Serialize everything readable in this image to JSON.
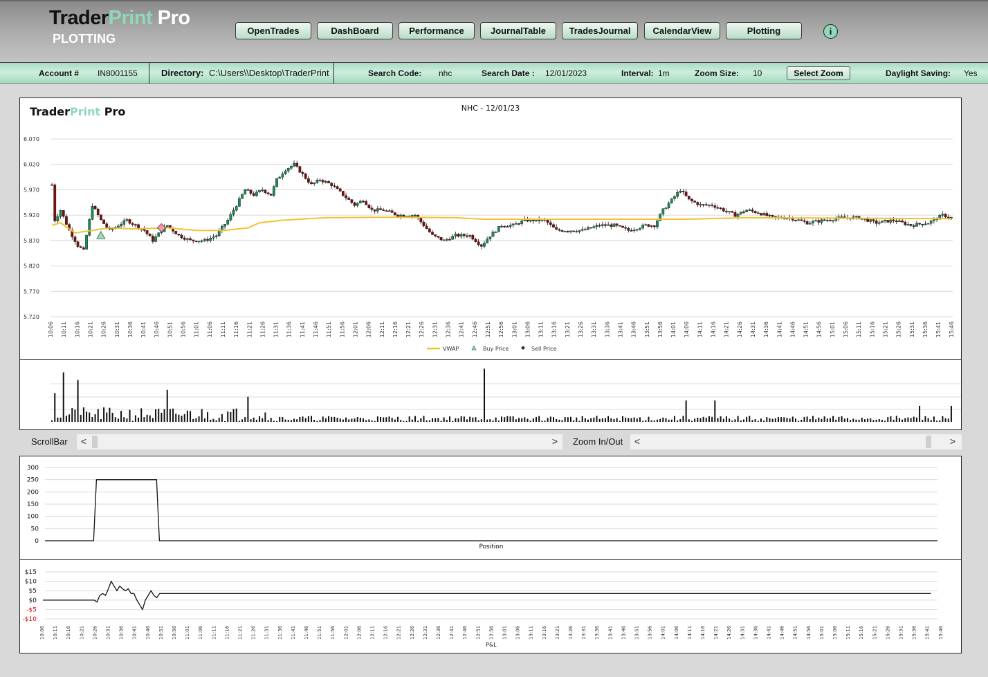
{
  "header": {
    "brand": {
      "part1": "Trader",
      "part2": "Print",
      "part3": " Pro"
    },
    "subtitle": "PLOTTING",
    "nav": [
      "OpenTrades",
      "DashBoard",
      "Performance",
      "JournalTable",
      "TradesJournal",
      "CalendarView",
      "Plotting"
    ],
    "info_icon": "i"
  },
  "toolbar": {
    "account_label": "Account #",
    "account_value": "IN8001155",
    "directory_label": "Directory:",
    "directory_value": "C:\\Users\\\\Desktop\\TraderPrint P",
    "search_code_label": "Search Code:",
    "search_code_value": "nhc",
    "search_date_label": "Search Date :",
    "search_date_value": "12/01/2023",
    "interval_label": "Interval:",
    "interval_value": "1m",
    "zoom_size_label": "Zoom Size:",
    "zoom_size_value": "10",
    "select_zoom_label": "Select Zoom",
    "daylight_label": "Daylight Saving:",
    "daylight_value": "Yes"
  },
  "scroll": {
    "scrollbar_label": "ScrollBar",
    "zoom_label": "Zoom In/Out",
    "left_arrow": "<",
    "right_arrow": ">",
    "scroll_position": 0.0,
    "zoom_position": 1.0
  },
  "colors": {
    "up": "#1e8a5a",
    "down": "#7a1010",
    "vwap": "#f2c12e",
    "buy": "#9fd9b9",
    "sell": "#f19aa8",
    "brand_accent": "#8fd8b8",
    "neg": "#d00000"
  },
  "chart_data": [
    {
      "type": "candlestick",
      "title": "NHC - 12/01/23",
      "watermark": {
        "part1": "Trader",
        "part2": "Print",
        "part3": " Pro"
      },
      "ylim": [
        5.72,
        6.07
      ],
      "yticks": [
        "5.720",
        "5.770",
        "5.820",
        "5.870",
        "5.920",
        "5.970",
        "6.020",
        "6.070"
      ],
      "xticks": [
        "10:06",
        "10:11",
        "10:16",
        "10:21",
        "10:26",
        "10:31",
        "10:36",
        "10:41",
        "10:46",
        "10:51",
        "10:56",
        "11:01",
        "11:06",
        "11:11",
        "11:16",
        "11:21",
        "11:26",
        "11:31",
        "11:36",
        "11:41",
        "11:46",
        "11:51",
        "11:56",
        "12:01",
        "12:06",
        "12:11",
        "12:16",
        "12:21",
        "12:26",
        "12:31",
        "12:36",
        "12:41",
        "12:46",
        "12:51",
        "12:56",
        "13:01",
        "13:06",
        "13:11",
        "13:16",
        "13:21",
        "13:26",
        "13:31",
        "13:36",
        "13:41",
        "13:46",
        "13:51",
        "13:56",
        "14:01",
        "14:06",
        "14:11",
        "14:16",
        "14:21",
        "14:26",
        "14:31",
        "14:36",
        "14:41",
        "14:46",
        "14:51",
        "14:56",
        "15:01",
        "15:06",
        "15:11",
        "15:16",
        "15:21",
        "15:26",
        "15:31",
        "15:36",
        "15:41",
        "15:46"
      ],
      "legend": [
        "VWAP",
        "Buy Price",
        "Sell Price"
      ],
      "legend_position": "bottom",
      "close_path_keypoints": [
        [
          0,
          5.98
        ],
        [
          1,
          5.91
        ],
        [
          3,
          5.93
        ],
        [
          6,
          5.89
        ],
        [
          9,
          5.86
        ],
        [
          11,
          5.85
        ],
        [
          14,
          5.94
        ],
        [
          17,
          5.91
        ],
        [
          20,
          5.89
        ],
        [
          23,
          5.9
        ],
        [
          26,
          5.91
        ],
        [
          29,
          5.9
        ],
        [
          32,
          5.89
        ],
        [
          35,
          5.87
        ],
        [
          38,
          5.89
        ],
        [
          40,
          5.9
        ],
        [
          44,
          5.88
        ],
        [
          48,
          5.87
        ],
        [
          53,
          5.87
        ],
        [
          57,
          5.88
        ],
        [
          61,
          5.91
        ],
        [
          64,
          5.94
        ],
        [
          67,
          5.97
        ],
        [
          70,
          5.96
        ],
        [
          73,
          5.97
        ],
        [
          76,
          5.96
        ],
        [
          78,
          5.99
        ],
        [
          81,
          6.01
        ],
        [
          84,
          6.02
        ],
        [
          87,
          6.0
        ],
        [
          90,
          5.98
        ],
        [
          93,
          5.99
        ],
        [
          97,
          5.98
        ],
        [
          101,
          5.96
        ],
        [
          105,
          5.94
        ],
        [
          108,
          5.95
        ],
        [
          111,
          5.93
        ],
        [
          115,
          5.93
        ],
        [
          120,
          5.92
        ],
        [
          126,
          5.92
        ],
        [
          129,
          5.9
        ],
        [
          132,
          5.88
        ],
        [
          136,
          5.87
        ],
        [
          140,
          5.88
        ],
        [
          145,
          5.88
        ],
        [
          149,
          5.86
        ],
        [
          152,
          5.88
        ],
        [
          156,
          5.9
        ],
        [
          160,
          5.9
        ],
        [
          164,
          5.91
        ],
        [
          168,
          5.91
        ],
        [
          171,
          5.91
        ],
        [
          175,
          5.89
        ],
        [
          180,
          5.89
        ],
        [
          184,
          5.89
        ],
        [
          190,
          5.9
        ],
        [
          195,
          5.9
        ],
        [
          200,
          5.89
        ],
        [
          206,
          5.9
        ],
        [
          209,
          5.9
        ],
        [
          212,
          5.93
        ],
        [
          215,
          5.95
        ],
        [
          218,
          5.97
        ],
        [
          221,
          5.95
        ],
        [
          225,
          5.94
        ],
        [
          229,
          5.94
        ],
        [
          233,
          5.93
        ],
        [
          237,
          5.92
        ],
        [
          241,
          5.93
        ],
        [
          245,
          5.925
        ],
        [
          250,
          5.915
        ],
        [
          256,
          5.915
        ],
        [
          262,
          5.905
        ],
        [
          268,
          5.91
        ],
        [
          274,
          5.915
        ],
        [
          280,
          5.915
        ],
        [
          286,
          5.905
        ],
        [
          292,
          5.91
        ],
        [
          298,
          5.9
        ],
        [
          304,
          5.905
        ],
        [
          309,
          5.92
        ],
        [
          312,
          5.915
        ]
      ],
      "vwap_keypoints": [
        [
          0,
          5.9
        ],
        [
          3,
          5.905
        ],
        [
          8,
          5.885
        ],
        [
          14,
          5.89
        ],
        [
          20,
          5.895
        ],
        [
          28,
          5.893
        ],
        [
          40,
          5.895
        ],
        [
          50,
          5.89
        ],
        [
          60,
          5.89
        ],
        [
          68,
          5.895
        ],
        [
          72,
          5.905
        ],
        [
          80,
          5.91
        ],
        [
          95,
          5.915
        ],
        [
          120,
          5.916
        ],
        [
          140,
          5.915
        ],
        [
          150,
          5.912
        ],
        [
          220,
          5.912
        ],
        [
          240,
          5.915
        ],
        [
          312,
          5.913
        ]
      ],
      "trades": [
        {
          "type": "buy",
          "index": 17,
          "price": 5.88
        },
        {
          "type": "sell",
          "index": 38,
          "price": 5.895
        }
      ]
    },
    {
      "type": "bar",
      "title": "Volume",
      "spikes": [
        [
          1,
          0.38
        ],
        [
          4,
          0.65
        ],
        [
          9,
          0.55
        ],
        [
          40,
          0.42
        ],
        [
          68,
          0.33
        ],
        [
          150,
          0.7
        ],
        [
          220,
          0.28
        ],
        [
          230,
          0.28
        ],
        [
          301,
          0.21
        ],
        [
          312,
          0.21
        ]
      ]
    },
    {
      "type": "line",
      "xlabel": "Position",
      "ylim": [
        0,
        300
      ],
      "yticks": [
        "0",
        "50",
        "100",
        "150",
        "200",
        "250",
        "300"
      ],
      "x_range": [
        0,
        312
      ],
      "points": [
        [
          0,
          0
        ],
        [
          17,
          0
        ],
        [
          18,
          250
        ],
        [
          39,
          250
        ],
        [
          40,
          0
        ],
        [
          312,
          0
        ]
      ]
    },
    {
      "type": "line",
      "xlabel": "P&L",
      "ylim": [
        -10,
        15
      ],
      "yticks": [
        "-$10",
        "-$5",
        "$0",
        "$5",
        "$10",
        "$15"
      ],
      "xticks": [
        "10:06",
        "10:11",
        "10:16",
        "10:21",
        "10:26",
        "10:31",
        "10:36",
        "10:41",
        "10:46",
        "10:51",
        "10:56",
        "11:01",
        "11:06",
        "11:11",
        "11:16",
        "11:21",
        "11:26",
        "11:31",
        "11:36",
        "11:41",
        "11:46",
        "11:51",
        "11:56",
        "12:01",
        "12:06",
        "12:11",
        "12:16",
        "12:21",
        "12:26",
        "12:31",
        "12:36",
        "12:41",
        "12:46",
        "12:51",
        "12:56",
        "13:01",
        "13:06",
        "13:11",
        "13:16",
        "13:21",
        "13:26",
        "13:31",
        "13:36",
        "13:41",
        "13:46",
        "13:51",
        "13:56",
        "14:01",
        "14:06",
        "14:11",
        "14:16",
        "14:21",
        "14:26",
        "14:31",
        "14:36",
        "14:41",
        "14:46",
        "14:51",
        "14:56",
        "15:01",
        "15:06",
        "15:11",
        "15:16",
        "15:21",
        "15:26",
        "15:31",
        "15:36",
        "15:41",
        "15:46"
      ],
      "points": [
        [
          0,
          0
        ],
        [
          18,
          0
        ],
        [
          19,
          -1
        ],
        [
          20,
          2.5
        ],
        [
          21,
          3.5
        ],
        [
          22,
          2.5
        ],
        [
          23,
          6
        ],
        [
          24,
          10
        ],
        [
          25,
          7.5
        ],
        [
          26,
          5
        ],
        [
          27,
          7.5
        ],
        [
          28,
          6
        ],
        [
          29,
          5
        ],
        [
          30,
          6
        ],
        [
          31,
          3.5
        ],
        [
          32,
          3.5
        ],
        [
          33,
          0
        ],
        [
          34,
          -2.5
        ],
        [
          35,
          -5
        ],
        [
          36,
          0
        ],
        [
          37,
          2.5
        ],
        [
          38,
          5
        ],
        [
          39,
          2.5
        ],
        [
          40,
          1.3
        ],
        [
          41,
          3.5
        ],
        [
          312,
          3.5
        ]
      ]
    }
  ]
}
